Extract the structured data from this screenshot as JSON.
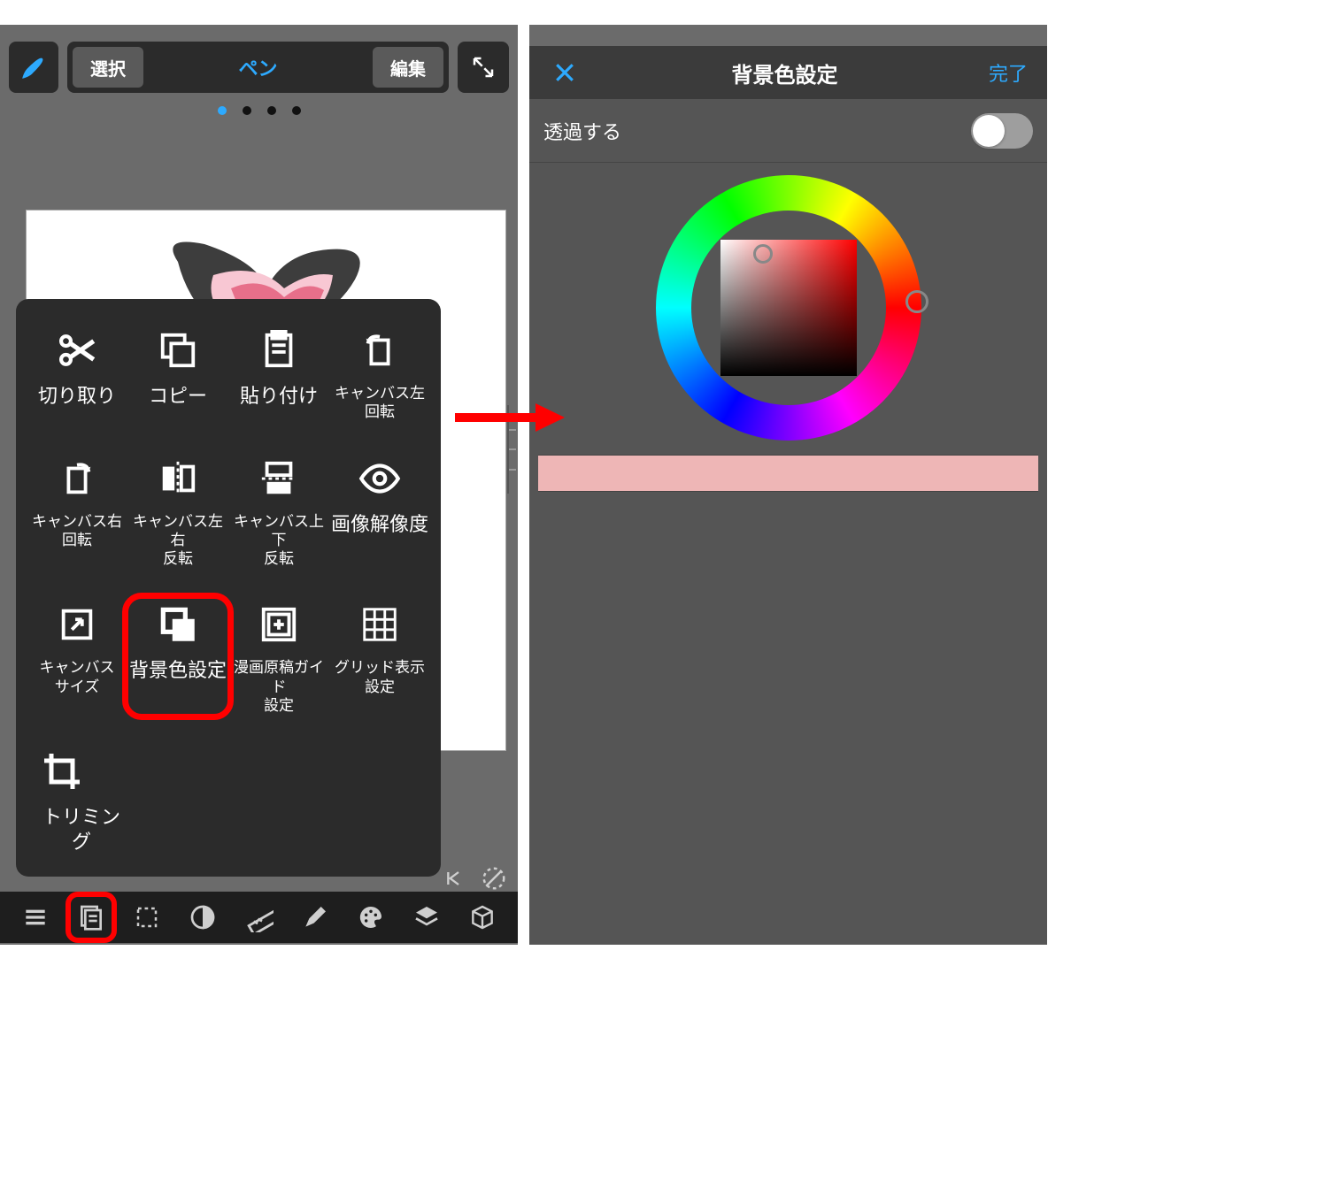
{
  "left": {
    "topbar": {
      "select": "選択",
      "pen": "ペン",
      "edit": "編集"
    },
    "popup": {
      "items": [
        {
          "id": "cut",
          "label": "切り取り"
        },
        {
          "id": "copy",
          "label": "コピー"
        },
        {
          "id": "paste",
          "label": "貼り付け"
        },
        {
          "id": "rot-left",
          "label": "キャンバス左\n回転"
        },
        {
          "id": "rot-right",
          "label": "キャンバス右\n回転"
        },
        {
          "id": "flip-h",
          "label": "キャンバス左右\n反転"
        },
        {
          "id": "flip-v",
          "label": "キャンバス上下\n反転"
        },
        {
          "id": "resolution",
          "label": "画像解像度"
        },
        {
          "id": "canvas-size",
          "label": "キャンバス\nサイズ"
        },
        {
          "id": "bg-color",
          "label": "背景色設定"
        },
        {
          "id": "manga-guide",
          "label": "漫画原稿ガイド\n設定"
        },
        {
          "id": "grid",
          "label": "グリッド表示\n設定"
        },
        {
          "id": "trim",
          "label": "トリミング"
        }
      ]
    }
  },
  "right": {
    "title": "背景色設定",
    "done": "完了",
    "transparent_label": "透過する",
    "transparent_on": false,
    "selected_color": "#eeb6b6"
  }
}
